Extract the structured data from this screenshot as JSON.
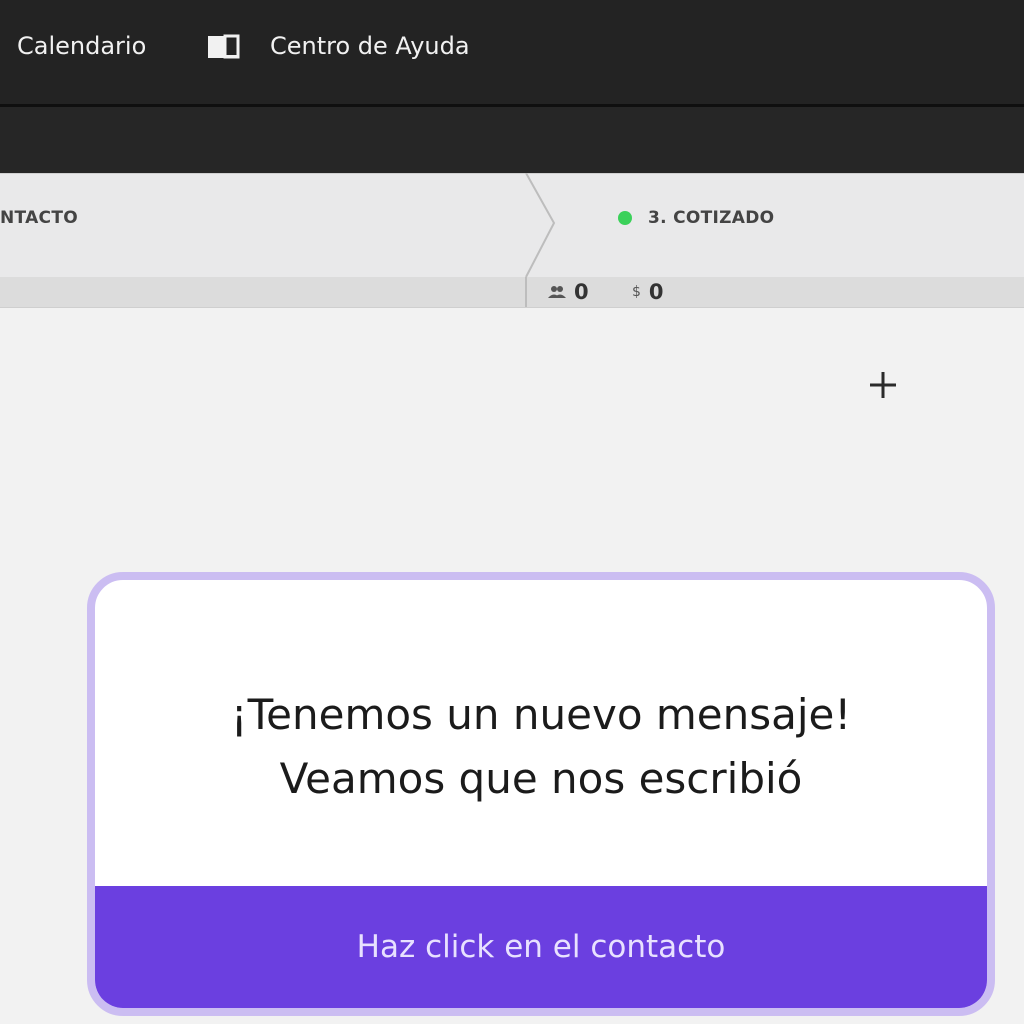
{
  "header": {
    "nav": {
      "calendar_label": "Calendario",
      "help_label": "Centro de Ayuda"
    }
  },
  "pipeline": {
    "stage_left_label": "NTACTO",
    "stage_right_label": "3. COTIZADO",
    "stage_right_status_color": "#3bd15a",
    "stats": {
      "contacts_count": "0",
      "money_symbol": "$",
      "amount": "0"
    }
  },
  "card": {
    "message_line1": "¡Tenemos un nuevo mensaje!",
    "message_line2": "Veamos que nos escribió",
    "action_label": "Haz click en el contacto",
    "accent_color": "#6b3fe0",
    "border_color": "#cbbdf2"
  }
}
